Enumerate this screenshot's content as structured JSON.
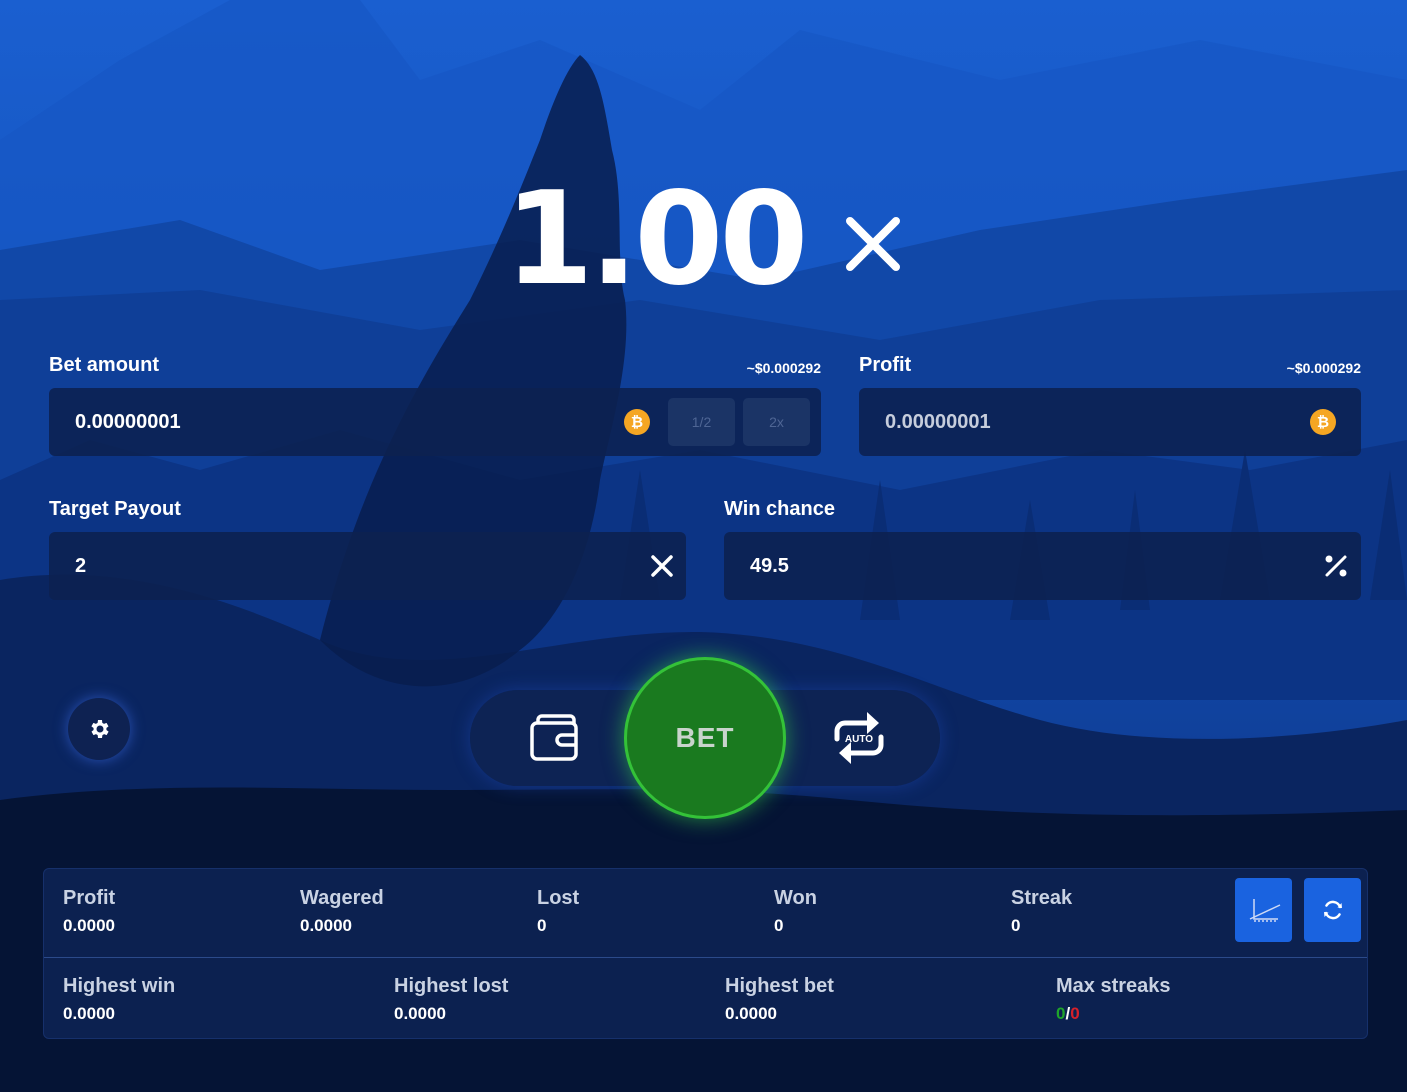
{
  "multiplier": {
    "value": "1.00"
  },
  "bet_amount": {
    "label": "Bet amount",
    "usd": "~$0.000292",
    "value": "0.00000001",
    "half_label": "1/2",
    "double_label": "2x"
  },
  "profit_field": {
    "label": "Profit",
    "usd": "~$0.000292",
    "value": "0.00000001"
  },
  "target_payout": {
    "label": "Target Payout",
    "value": "2"
  },
  "win_chance": {
    "label": "Win chance",
    "value": "49.5"
  },
  "controls": {
    "bet_label": "BET",
    "auto_label": "AUTO"
  },
  "stats": {
    "row1": [
      {
        "label": "Profit",
        "value": "0.0000"
      },
      {
        "label": "Wagered",
        "value": "0.0000"
      },
      {
        "label": "Lost",
        "value": "0"
      },
      {
        "label": "Won",
        "value": "0"
      },
      {
        "label": "Streak",
        "value": "0"
      }
    ],
    "row2": [
      {
        "label": "Highest win",
        "value": "0.0000"
      },
      {
        "label": "Highest lost",
        "value": "0.0000"
      },
      {
        "label": "Highest bet",
        "value": "0.0000"
      },
      {
        "label": "Max streaks",
        "win_value": "0",
        "separator": "/",
        "loss_value": "0"
      }
    ]
  },
  "colors": {
    "bet_green": "#1a7a1f",
    "accent_blue": "#1a63e0",
    "bitcoin_orange": "#f5a623",
    "win_green": "#1ea42a",
    "loss_red": "#d6202a"
  },
  "icons": [
    "bitcoin-icon",
    "multiply-icon",
    "percent-icon",
    "gear-icon",
    "wallet-icon",
    "auto-repeat-icon",
    "chart-icon",
    "refresh-icon"
  ]
}
